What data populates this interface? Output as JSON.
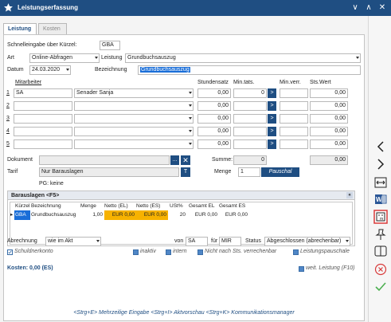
{
  "window": {
    "title": "Leistungserfassung"
  },
  "tabs": [
    {
      "label": "Leistung"
    },
    {
      "label": "Kosten"
    }
  ],
  "form": {
    "schnelleingabe_label": "Schnelleingabe über Kürzel:",
    "schnelleingabe_value": "GBA",
    "art_label": "Art",
    "art_value": "Online-Abfragen",
    "leistung_label": "Leistung",
    "leistung_value": "Grundbuchsauszug",
    "datum_label": "Datum",
    "datum_value": "24.03.2020",
    "bezeichnung_label": "Bezeichnung",
    "bezeichnung_value": "Grundbuchsauszug"
  },
  "staff_table": {
    "headers": {
      "mitarbeiter": "Mitarbeiter",
      "stundensatz": "Stundensatz",
      "min_tats": "Min.tats.",
      "min_verr": "Min.verr.",
      "sts_wert": "Sts.Wert"
    },
    "rows": [
      {
        "num": "1",
        "kuerzel": "SA",
        "name": "Senader Sanja",
        "stundensatz": "0,00",
        "min_tats": "0",
        "sts_wert": "0,00"
      },
      {
        "num": "2",
        "kuerzel": "",
        "name": "",
        "stundensatz": "0,00",
        "min_tats": "",
        "sts_wert": "0,00"
      },
      {
        "num": "3",
        "kuerzel": "",
        "name": "",
        "stundensatz": "0,00",
        "min_tats": "",
        "sts_wert": "0,00"
      },
      {
        "num": "4",
        "kuerzel": "",
        "name": "",
        "stundensatz": "0,00",
        "min_tats": "",
        "sts_wert": "0,00"
      },
      {
        "num": "5",
        "kuerzel": "",
        "name": "",
        "stundensatz": "0,00",
        "min_tats": "",
        "sts_wert": "0,00"
      }
    ],
    "arrow_label": ">"
  },
  "dokument": {
    "label": "Dokument",
    "dots": "..."
  },
  "tarif": {
    "label": "Tarif",
    "value": "Nur Barauslagen",
    "btn": "T"
  },
  "pg": {
    "label": "PG:",
    "value": "keine"
  },
  "summe": {
    "label": "Summe:",
    "value1": "0",
    "value2": "0,00"
  },
  "menge": {
    "label": "Menge",
    "value": "1",
    "pauschal_label": "Pauschal"
  },
  "barauslagen": {
    "title": "Barauslagen <F5>",
    "collapse": "«",
    "headers": [
      "Kürzel",
      "Bezeichnung",
      "Menge",
      "Netto (EL)",
      "Netto (ES)",
      "USt%",
      "Gesamt EL",
      "Gesamt ES"
    ],
    "row": {
      "kuerzel": "GBA",
      "bezeichnung": "Grundbuchsauszug",
      "menge": "1,00",
      "netto_el": "EUR 0,00",
      "netto_es": "EUR 0,00",
      "ust": "20",
      "gesamt_el": "EUR 0,00",
      "gesamt_es": "EUR 0,00"
    }
  },
  "abrechnung": {
    "label": "Abrechnung",
    "value": "wie im Akt"
  },
  "von": {
    "label": "von",
    "value": "SA"
  },
  "fuer": {
    "label": "für",
    "value": "MIR"
  },
  "status": {
    "label": "Status",
    "value": "Abgeschlossen (abrechenbar)"
  },
  "checks": {
    "schuldnerkonto": "Schuldnerkonto",
    "inaktiv": "inaktiv",
    "intern": "intern",
    "nicht_verrechenbar": "Nicht nach Sts. verrechenbar",
    "leistungspauschale": "Leistungspauschale",
    "weit_leistung": "weit. Leistung (F10)"
  },
  "kosten": {
    "text": "Kosten: 0,00 (ES)"
  },
  "footer": {
    "hint": "<Strg+E> Mehrzeilige Eingabe <Strg+I> Aktvorschau <Strg+K> Kommunikationsmanager"
  },
  "colors": {
    "title_bar": "#1f4e82",
    "selection": "#1a6ed8",
    "orange": "#f7b200",
    "close_red": "#d83a3a",
    "check_green": "#4caf50"
  }
}
